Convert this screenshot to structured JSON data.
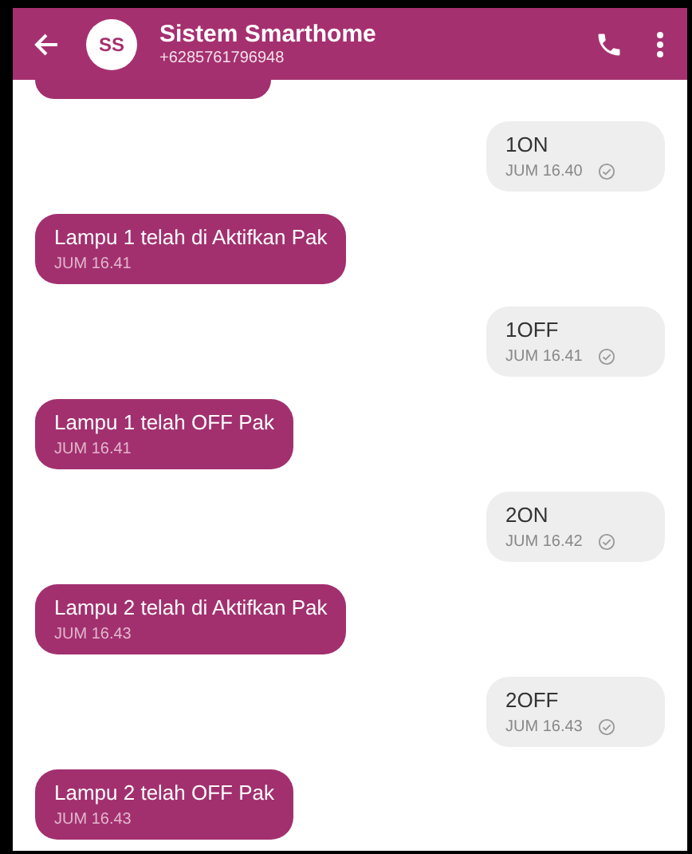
{
  "header": {
    "avatar": "SS",
    "title": "Sistem Smarthome",
    "subtitle": "+6285761796948"
  },
  "messages": [
    {
      "kind": "incoming",
      "cut": true
    },
    {
      "kind": "outgoing",
      "text": "1ON",
      "time": "JUM 16.40",
      "delivered": true
    },
    {
      "kind": "incoming",
      "text": "Lampu 1 telah di Aktifkan Pak",
      "time": "JUM 16.41"
    },
    {
      "kind": "outgoing",
      "text": "1OFF",
      "time": "JUM 16.41",
      "delivered": true
    },
    {
      "kind": "incoming",
      "text": "Lampu 1 telah OFF Pak",
      "time": "JUM 16.41"
    },
    {
      "kind": "outgoing",
      "text": "2ON",
      "time": "JUM 16.42",
      "delivered": true
    },
    {
      "kind": "incoming",
      "text": "Lampu 2 telah di Aktifkan Pak",
      "time": "JUM 16.43"
    },
    {
      "kind": "outgoing",
      "text": "2OFF",
      "time": "JUM 16.43",
      "delivered": true
    },
    {
      "kind": "incoming",
      "text": "Lampu 2 telah OFF Pak",
      "time": "JUM 16.43"
    }
  ]
}
